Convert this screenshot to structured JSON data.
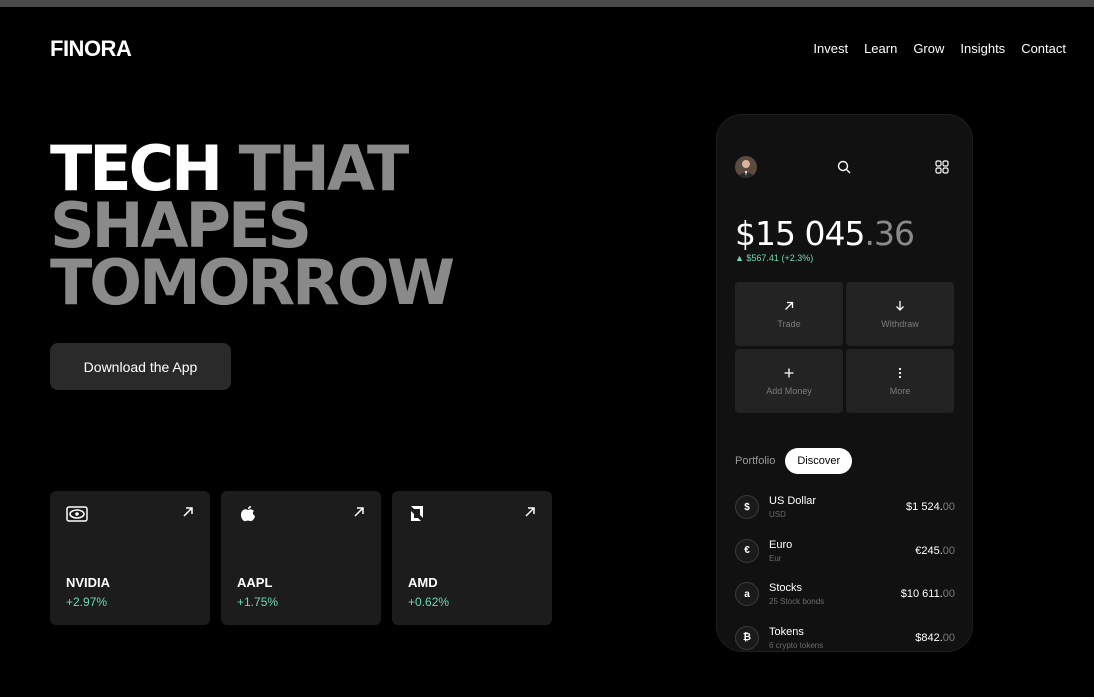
{
  "brand": {
    "name": "FINORA"
  },
  "nav": {
    "items": [
      "Invest",
      "Learn",
      "Grow",
      "Insights",
      "Contact"
    ]
  },
  "hero": {
    "line1_white": "TECH",
    "line1_gray": "THAT",
    "line2": "SHAPES",
    "line3": "TOMORROW"
  },
  "cta": {
    "download_label": "Download the App"
  },
  "stocks": [
    {
      "name": "NVIDIA",
      "change": "+2.97%",
      "icon": "nvidia-logo-icon"
    },
    {
      "name": "AAPL",
      "change": "+1.75%",
      "icon": "apple-logo-icon"
    },
    {
      "name": "AMD",
      "change": "+0.62%",
      "icon": "amd-logo-icon"
    }
  ],
  "phone": {
    "balance_main": "$15 045",
    "balance_cents": ".36",
    "balance_change": "▲ $567.41 (+2.3%)",
    "actions": [
      {
        "label": "Trade",
        "icon": "arrow-up-right-icon"
      },
      {
        "label": "Withdraw",
        "icon": "arrow-down-icon"
      },
      {
        "label": "Add Money",
        "icon": "plus-icon"
      },
      {
        "label": "More",
        "icon": "more-vertical-icon"
      }
    ],
    "tabs": {
      "portfolio": "Portfolio",
      "discover": "Discover"
    },
    "assets": [
      {
        "symbol": "$",
        "name": "US Dollar",
        "sub": "USD",
        "value_main": "$1 524.",
        "value_dec": "00"
      },
      {
        "symbol": "€",
        "name": "Euro",
        "sub": "Eur",
        "value_main": "€245.",
        "value_dec": "00"
      },
      {
        "symbol": "a",
        "name": "Stocks",
        "sub": "25 Stock bonds",
        "value_main": "$10 611.",
        "value_dec": "00"
      },
      {
        "symbol": "₿",
        "name": "Tokens",
        "sub": "6 crypto tokens",
        "value_main": "$842.",
        "value_dec": "00"
      }
    ]
  },
  "colors": {
    "accent_green": "#6fd8b0",
    "background": "#000000",
    "card": "#1c1c1c"
  }
}
